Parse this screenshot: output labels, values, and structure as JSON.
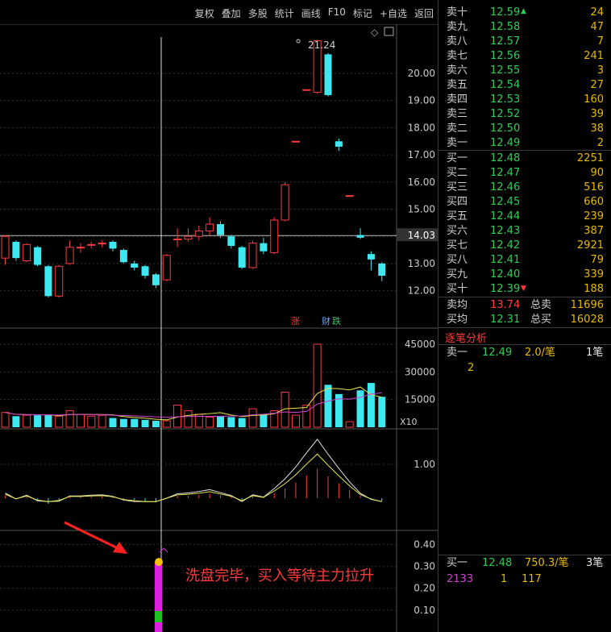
{
  "toolbar": {
    "items": [
      "复权",
      "叠加",
      "多股",
      "统计",
      "画线",
      "F10",
      "标记",
      "+自选",
      "返回"
    ]
  },
  "price_axis": {
    "ticks": [
      "20.00",
      "19.00",
      "18.00",
      "17.00",
      "16.00",
      "15.00",
      "14.00",
      "13.00",
      "12.00"
    ],
    "current": "14.03",
    "high_label": "21.24"
  },
  "volume_axis": {
    "ticks": [
      "45000",
      "30000",
      "15000"
    ],
    "unit": "X10"
  },
  "macd_axis": {
    "ticks": [
      "1.00"
    ]
  },
  "ind_axis": {
    "ticks": [
      "0.40",
      "0.30",
      "0.20",
      "0.10"
    ]
  },
  "markers": {
    "zhang": "涨",
    "cai": "财",
    "die": "跌"
  },
  "annotation": "洗盘完毕，买入等待主力拉升",
  "colors": {
    "up": "#ff3b3b",
    "down": "#3ee8f0",
    "ma_yellow": "#e6e64a",
    "ma_magenta": "#d040d0",
    "ma_white": "#e0e0e0"
  },
  "chart_data": {
    "type": "candlestick",
    "ylim": [
      11.6,
      21.6
    ],
    "candles": [
      [
        13.2,
        14.0,
        14.05,
        12.95
      ],
      [
        13.8,
        13.2,
        13.85,
        13.1
      ],
      [
        13.1,
        13.7,
        13.75,
        13.05
      ],
      [
        13.6,
        12.95,
        13.65,
        12.9
      ],
      [
        12.9,
        11.8,
        12.95,
        11.75
      ],
      [
        11.8,
        12.9,
        12.95,
        11.75
      ],
      [
        13.0,
        13.6,
        13.85,
        12.95
      ],
      [
        13.6,
        13.6,
        13.75,
        13.4
      ],
      [
        13.7,
        13.7,
        13.8,
        13.55
      ],
      [
        13.75,
        13.75,
        13.85,
        13.6
      ],
      [
        13.8,
        13.55,
        13.85,
        13.45
      ],
      [
        13.5,
        13.05,
        13.55,
        13.0
      ],
      [
        13.0,
        12.85,
        13.1,
        12.75
      ],
      [
        12.9,
        12.55,
        12.95,
        12.45
      ],
      [
        12.6,
        12.2,
        12.65,
        12.1
      ],
      [
        12.4,
        13.3,
        13.35,
        12.35
      ],
      [
        13.9,
        13.9,
        14.3,
        13.6
      ],
      [
        13.9,
        14.0,
        14.3,
        13.8
      ],
      [
        14.0,
        14.2,
        14.4,
        13.85
      ],
      [
        14.2,
        14.45,
        14.7,
        14.05
      ],
      [
        14.45,
        14.05,
        14.55,
        13.95
      ],
      [
        14.0,
        13.65,
        14.05,
        13.55
      ],
      [
        13.6,
        12.85,
        13.65,
        12.8
      ],
      [
        12.85,
        13.75,
        13.85,
        12.8
      ],
      [
        13.75,
        13.45,
        13.95,
        13.35
      ],
      [
        13.4,
        14.6,
        14.7,
        13.35
      ],
      [
        14.6,
        15.9,
        16.0,
        14.55
      ],
      [
        17.5,
        17.5,
        17.5,
        17.5
      ],
      [
        19.4,
        19.4,
        19.4,
        19.4
      ],
      [
        19.3,
        21.2,
        21.24,
        19.25
      ],
      [
        20.7,
        19.2,
        20.75,
        19.15
      ],
      [
        17.5,
        17.3,
        17.6,
        17.15
      ],
      [
        15.5,
        15.5,
        15.5,
        15.5
      ],
      [
        14.05,
        13.95,
        14.3,
        13.9
      ],
      [
        13.35,
        13.15,
        13.45,
        12.75
      ],
      [
        13.0,
        12.55,
        13.05,
        12.35
      ]
    ],
    "volume_ylim": [
      0,
      50000
    ],
    "volumes": [
      8000,
      6000,
      6500,
      6500,
      6500,
      6000,
      9000,
      7000,
      6000,
      6500,
      5000,
      4500,
      4500,
      4000,
      3500,
      3500,
      12000,
      9000,
      7000,
      5500,
      6000,
      5500,
      5000,
      10000,
      7000,
      9000,
      19000,
      6500,
      12000,
      45000,
      23000,
      18000,
      3000,
      20000,
      24000,
      16500
    ],
    "macd_ylim": [
      -0.5,
      1.4
    ],
    "indicator_ylim": [
      0,
      0.42
    ],
    "indicator_spike": 0.32
  }
}
